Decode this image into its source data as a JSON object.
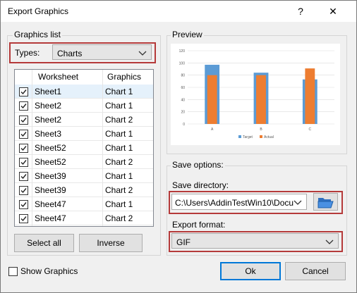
{
  "window": {
    "title": "Export Graphics",
    "help_glyph": "?",
    "close_glyph": "✕"
  },
  "graphics_list": {
    "group_label": "Graphics list",
    "types_label": "Types:",
    "types_value": "Charts",
    "columns": [
      "Worksheet",
      "Graphics"
    ],
    "rows": [
      {
        "sheet": "Sheet1",
        "graphic": "Chart 1",
        "checked": true,
        "selected": true
      },
      {
        "sheet": "Sheet2",
        "graphic": "Chart 1",
        "checked": true
      },
      {
        "sheet": "Sheet2",
        "graphic": "Chart 2",
        "checked": true
      },
      {
        "sheet": "Sheet3",
        "graphic": "Chart 1",
        "checked": true
      },
      {
        "sheet": "Sheet52",
        "graphic": "Chart 1",
        "checked": true
      },
      {
        "sheet": "Sheet52",
        "graphic": "Chart 2",
        "checked": true
      },
      {
        "sheet": "Sheet39",
        "graphic": "Chart 1",
        "checked": true
      },
      {
        "sheet": "Sheet39",
        "graphic": "Chart 2",
        "checked": true
      },
      {
        "sheet": "Sheet47",
        "graphic": "Chart 1",
        "checked": true
      },
      {
        "sheet": "Sheet47",
        "graphic": "Chart 2",
        "checked": true
      }
    ],
    "select_all_label": "Select all",
    "inverse_label": "Inverse"
  },
  "preview": {
    "label": "Preview",
    "chart_data": {
      "type": "bar",
      "categories": [
        "A",
        "B",
        "C"
      ],
      "series": [
        {
          "name": "Target",
          "values": [
            97,
            84,
            73
          ],
          "color": "#5b9bd5"
        },
        {
          "name": "Actual",
          "values": [
            80,
            80,
            91
          ],
          "color": "#ed7d31"
        }
      ],
      "ylim": [
        0,
        120
      ],
      "yticks": [
        "0",
        "20",
        "40",
        "60",
        "80",
        "100",
        "120"
      ],
      "legend": "bottom",
      "grid": true
    }
  },
  "save_options": {
    "group_label": "Save options:",
    "directory_label": "Save directory:",
    "directory_value": "C:\\Users\\AddinTestWin10\\Docu",
    "format_label": "Export format:",
    "format_value": "GIF"
  },
  "footer": {
    "show_graphics_label": "Show Graphics",
    "show_graphics_checked": false,
    "ok_label": "Ok",
    "cancel_label": "Cancel"
  },
  "colors": {
    "highlight": "#b53a3a",
    "selection": "#e5f1fb",
    "default_border": "#0078d7"
  }
}
